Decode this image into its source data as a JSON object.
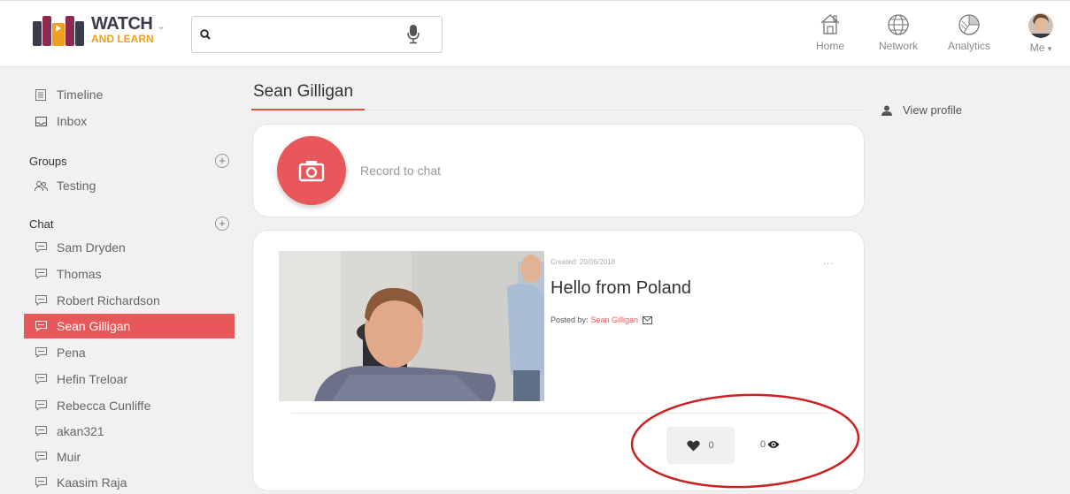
{
  "header": {
    "logo": {
      "line1": "WATCH",
      "line2": "AND LEARN"
    },
    "search": {
      "value": "",
      "placeholder": ""
    },
    "nav": [
      {
        "label": "Home",
        "icon": "home-icon"
      },
      {
        "label": "Network",
        "icon": "globe-icon"
      },
      {
        "label": "Analytics",
        "icon": "analytics-icon"
      },
      {
        "label": "Me",
        "icon": "avatar"
      }
    ]
  },
  "sidebar": {
    "top_items": [
      {
        "label": "Timeline",
        "icon": "timeline-icon"
      },
      {
        "label": "Inbox",
        "icon": "inbox-icon"
      }
    ],
    "groups_heading": "Groups",
    "groups": [
      {
        "label": "Testing",
        "icon": "group-icon"
      }
    ],
    "chat_heading": "Chat",
    "chats": [
      {
        "label": "Sam Dryden"
      },
      {
        "label": "Thomas"
      },
      {
        "label": "Robert Richardson"
      },
      {
        "label": "Sean Gilligan",
        "active": true
      },
      {
        "label": "Pena"
      },
      {
        "label": "Hefin Treloar"
      },
      {
        "label": "Rebecca Cunliffe"
      },
      {
        "label": "akan321"
      },
      {
        "label": "Muir"
      },
      {
        "label": "Kaasim Raja"
      }
    ]
  },
  "main": {
    "title": "Sean Gilligan",
    "record_label": "Record to chat",
    "post": {
      "created": "Created: 20/06/2018",
      "more": "...",
      "title": "Hello from Poland",
      "posted_by_label": "Posted by:",
      "author": "Sean Gilligan",
      "likes": "0",
      "views": "0"
    }
  },
  "right": {
    "view_profile": "View profile"
  },
  "colors": {
    "accent": "#e8575a",
    "annotation": "#cc2020"
  }
}
